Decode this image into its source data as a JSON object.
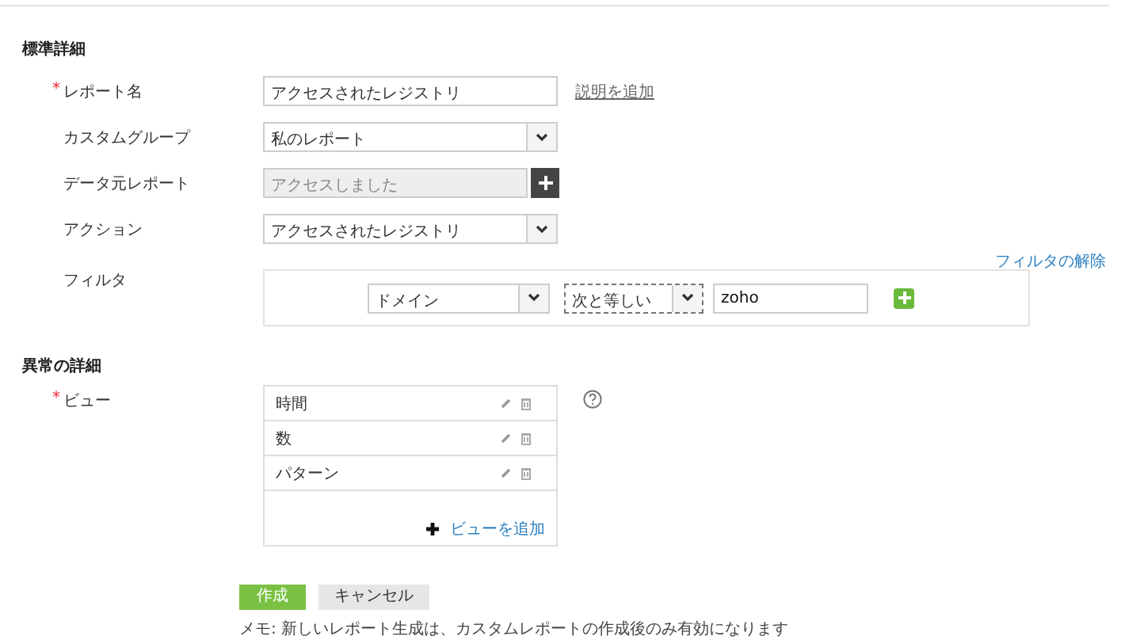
{
  "sections": [
    {
      "title": "標準詳細"
    },
    {
      "title": "異常の詳細"
    }
  ],
  "fields": [
    {
      "kind": "text",
      "label": "レポート名",
      "required_mark": "*",
      "value": "アクセスされたレジストリ",
      "link": "説明を追加"
    },
    {
      "kind": "select",
      "label": "カスタムグループ",
      "value": "私のレポート"
    },
    {
      "kind": "readonly",
      "label": "データ元レポート",
      "value": "アクセスしました"
    },
    {
      "kind": "select",
      "label": "アクション",
      "value": "アクセスされたレジストリ"
    }
  ],
  "filter": {
    "label": "フィルタ",
    "clear_link": "フィルタの解除",
    "field": "ドメイン",
    "operator": "次と等しい",
    "value": "zoho"
  },
  "views": {
    "label": "ビュー",
    "required_mark": "*",
    "items": [
      "時間",
      "数",
      "パターン"
    ],
    "add_link": "ビューを追加"
  },
  "buttons": [
    {
      "kind": "primary",
      "label": "作成"
    },
    {
      "kind": "secondary",
      "label": "キャンセル"
    }
  ],
  "note": "メモ: 新しいレポート生成は、カスタムレポートの作成後のみ有効になります"
}
